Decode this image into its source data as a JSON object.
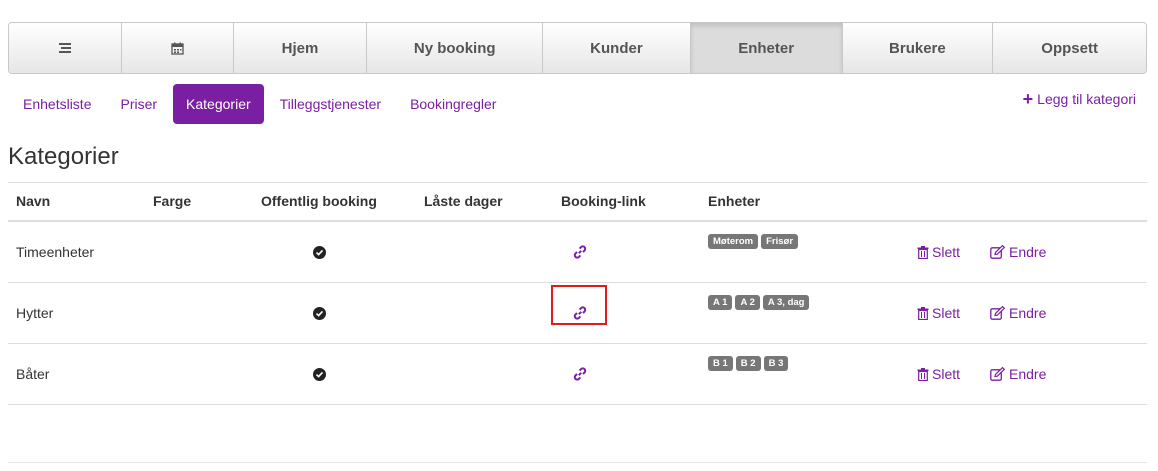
{
  "topnav": {
    "items": [
      {
        "label": "",
        "icon": "menu-icon"
      },
      {
        "label": "",
        "icon": "calendar-icon"
      },
      {
        "label": "Hjem"
      },
      {
        "label": "Ny booking"
      },
      {
        "label": "Kunder"
      },
      {
        "label": "Enheter",
        "active": true
      },
      {
        "label": "Brukere"
      },
      {
        "label": "Oppsett"
      }
    ]
  },
  "subtabs": {
    "items": [
      {
        "label": "Enhetsliste"
      },
      {
        "label": "Priser"
      },
      {
        "label": "Kategorier",
        "active": true
      },
      {
        "label": "Tilleggstjenester"
      },
      {
        "label": "Bookingregler"
      }
    ],
    "add_label": "Legg til kategori"
  },
  "page": {
    "title": "Kategorier"
  },
  "table": {
    "headers": {
      "name": "Navn",
      "color": "Farge",
      "public_booking": "Offentlig booking",
      "locked_days": "Låste dager",
      "booking_link": "Booking-link",
      "units": "Enheter"
    },
    "rows": [
      {
        "name": "Timeenheter",
        "public": true,
        "units": [
          "Møterom",
          "Frisør"
        ],
        "delete": "Slett",
        "edit": "Endre"
      },
      {
        "name": "Hytter",
        "public": true,
        "units": [
          "A 1",
          "A 2",
          "A 3, dag"
        ],
        "delete": "Slett",
        "edit": "Endre"
      },
      {
        "name": "Båter",
        "public": true,
        "units": [
          "B 1",
          "B 2",
          "B 3"
        ],
        "delete": "Slett",
        "edit": "Endre"
      }
    ]
  },
  "colors": {
    "accent": "#7b1fa2",
    "badge": "#777777",
    "highlight": "#e01b1b"
  }
}
